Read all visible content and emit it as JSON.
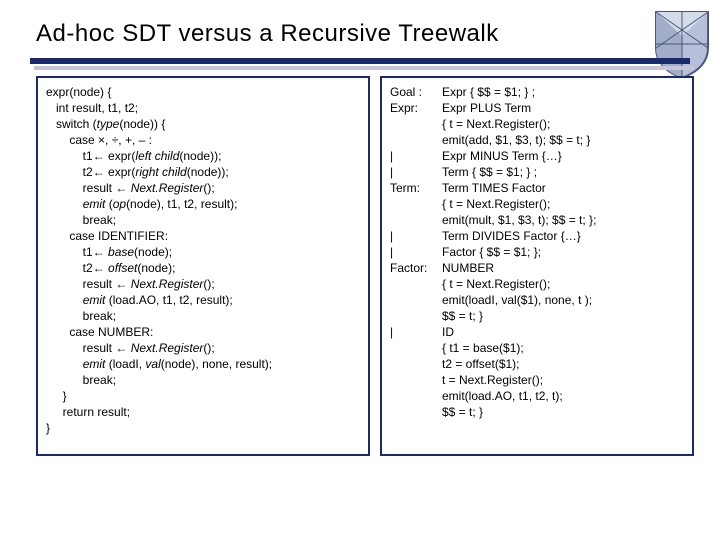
{
  "title": "Ad-hoc SDT versus a Recursive Treewalk",
  "left_code": {
    "l1": "expr(node) {",
    "l2": "   int result, t1, t2;",
    "l3": "   switch (",
    "l3b": "type",
    "l3c": "(node)) {",
    "l4": "       case ×, ÷, +, – :",
    "l5a": "           t1← expr(",
    "l5b": "left child",
    "l5c": "(node));",
    "l6a": "           t2← expr(",
    "l6b": "right child",
    "l6c": "(node));",
    "l7a": "           result ← ",
    "l7b": "Next.Register",
    "l7c": "();",
    "l8a": "           ",
    "l8b": "emit",
    "l8c": " (",
    "l8d": "op",
    "l8e": "(node), t1, t2, result);",
    "l9": "           break;",
    "l10": "       case IDENTIFIER:",
    "l11a": "           t1← ",
    "l11b": "base",
    "l11c": "(node);",
    "l12a": "           t2← ",
    "l12b": "offset",
    "l12c": "(node);",
    "l13a": "           result ← ",
    "l13b": "Next.Register",
    "l13c": "();",
    "l14a": "           ",
    "l14b": "emit",
    "l14c": " (load.AO, t1, t2, result);",
    "l15": "           break;",
    "l16": "       case NUMBER:",
    "l17a": "           result ← ",
    "l17b": "Next.Register",
    "l17c": "();",
    "l18a": "           ",
    "l18b": "emit",
    "l18c": " (loadI, ",
    "l18d": "val",
    "l18e": "(node), none, result);",
    "l19": "           break;",
    "l20": "     }",
    "l21": "     return result;",
    "l22": "}"
  },
  "grammar": {
    "r1l": "Goal :",
    "r1": "Expr  { $$ = $1; } ;",
    "r2l": "Expr:",
    "r2": "Expr PLUS Term",
    "r3l": "",
    "r3": "{ t = Next.Register();",
    "r4l": "",
    "r4": "  emit(add, $1, $3, t);  $$ = t; }",
    "r5l": "    |",
    "r5": "Expr MINUS Term  {…}",
    "r6l": "    |",
    "r6": "Term { $$ = $1; } ;",
    "r7l": "Term:",
    "r7": "Term TIMES Factor",
    "r8l": "",
    "r8": "{ t = Next.Register();",
    "r9l": "",
    "r9": "  emit(mult, $1, $3, t); $$ = t; };",
    "r10l": "    |",
    "r10": "Term DIVIDES Factor {…}",
    "r11l": "    |",
    "r11": "Factor { $$ = $1; };",
    "r12l": "Factor:",
    "r12": "NUMBER",
    "r13l": "",
    "r13": "{ t = Next.Register();",
    "r14l": "",
    "r14": "  emit(loadI, val($1), none, t );",
    "r15l": "",
    "r15": "  $$ = t; }",
    "r16l": "    |",
    "r16": "ID",
    "r17l": "",
    "r17": "  { t1 = base($1);",
    "r18l": "",
    "r18": "    t2 = offset($1);",
    "r19l": "",
    "r19": "    t  = Next.Register();",
    "r20l": "",
    "r20": "    emit(load.AO, t1, t2, t);",
    "r21l": "",
    "r21": "    $$ =  t; }"
  }
}
